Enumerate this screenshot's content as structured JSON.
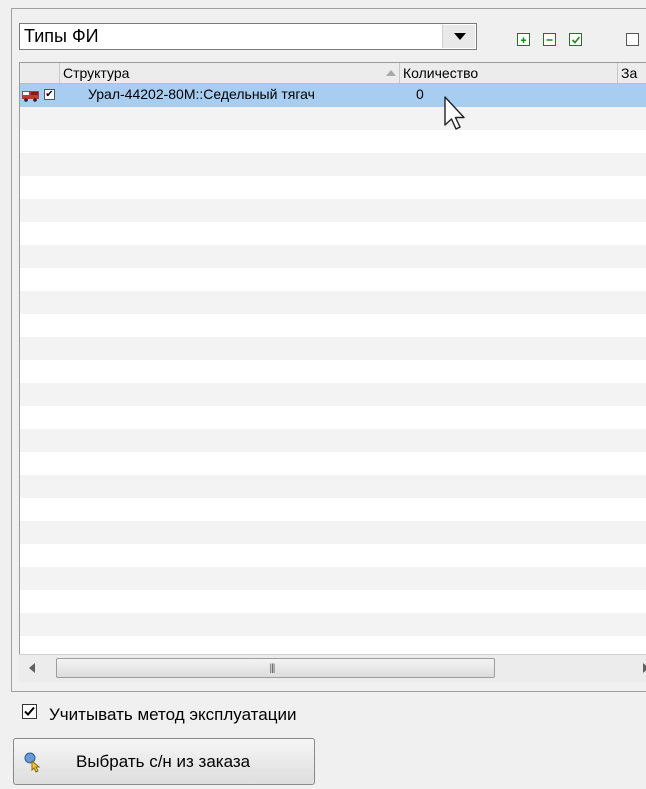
{
  "combo": {
    "value": "Типы ФИ"
  },
  "toolbar": {
    "buttons": [
      {
        "name": "expand-all",
        "icon": "plus-icon"
      },
      {
        "name": "collapse-all",
        "icon": "minus-icon"
      },
      {
        "name": "check-all",
        "icon": "checked-box-icon"
      },
      {
        "name": "uncheck-all",
        "icon": "empty-box-icon"
      }
    ]
  },
  "grid": {
    "columns": [
      "Структура",
      "Количество",
      "За"
    ],
    "rows": [
      {
        "name": "Урал-44202-80М::Седельный тягач",
        "quantity": "0",
        "checked": true,
        "icon": "truck-icon",
        "selected": true
      }
    ],
    "empty_rows": 23
  },
  "options": {
    "consider_operation_method_label": "Учитывать метод эксплуатации",
    "consider_operation_method_checked": true
  },
  "actions": {
    "select_serial_label": "Выбрать с/н из заказа"
  },
  "colors": {
    "selection": "#a7cdf0",
    "alt_row": "#f3f3f3"
  }
}
